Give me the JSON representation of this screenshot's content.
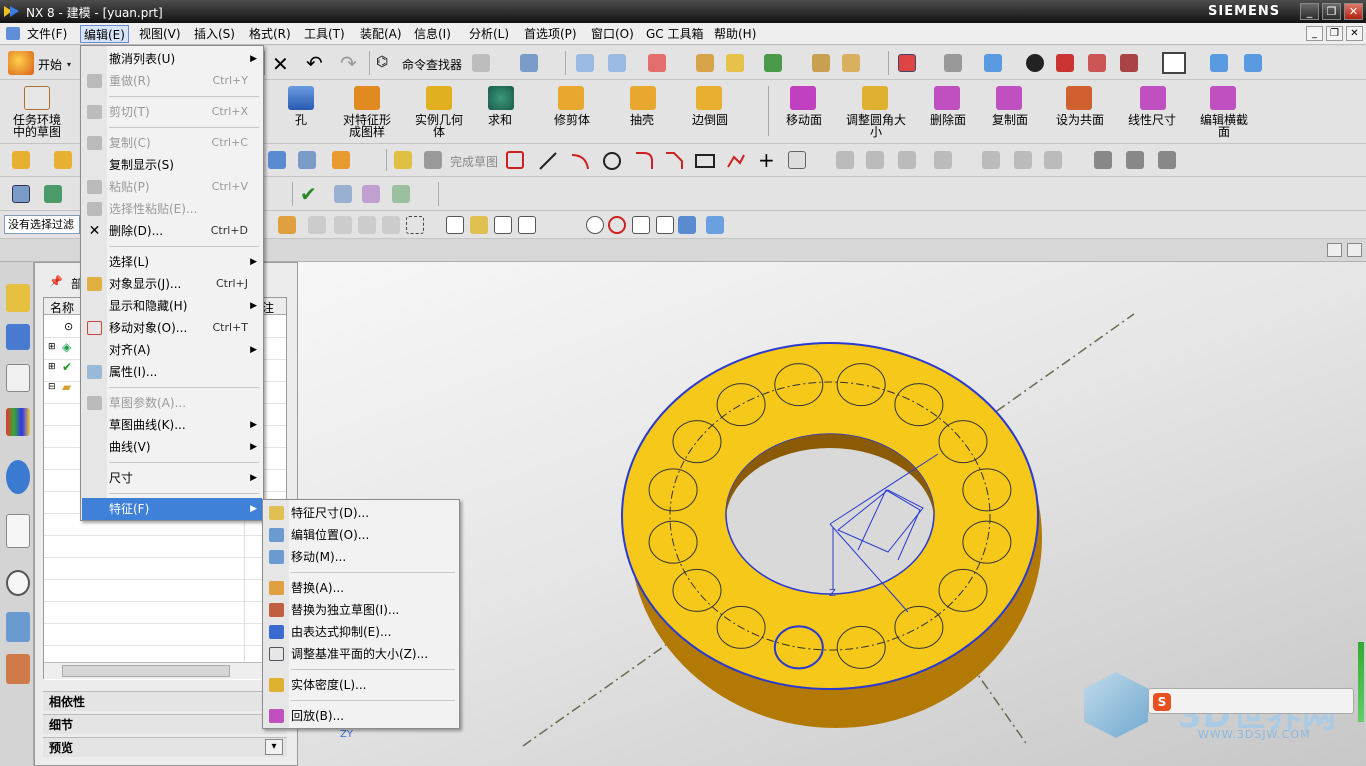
{
  "app": {
    "title": "NX 8 - 建模 - [yuan.prt]",
    "brand": "SIEMENS"
  },
  "menubar": [
    "编辑(E)",
    "视图(V)",
    "插入(S)",
    "格式(R)",
    "工具(T)",
    "装配(A)",
    "信息(I)",
    "分析(L)",
    "首选项(P)",
    "窗口(O)",
    "GC 工具箱",
    "帮助(H)"
  ],
  "menubar_file": "文件(F)",
  "toolbar1": {
    "start": "开始",
    "cmd_finder": "命令查找器"
  },
  "toolbar2": {
    "items": [
      "任务环境中的草图",
      "对特征形成图样",
      "实例几何体",
      "求和",
      "修剪体",
      "抽壳",
      "边倒圆",
      "移动面",
      "调整圆角大小",
      "删除面",
      "复制面",
      "设为共面",
      "线性尺寸",
      "编辑横截面"
    ],
    "hole": "孔"
  },
  "toolbar3": {
    "finish_sketch": "完成草图"
  },
  "selection_filter": "没有选择过滤",
  "edit_menu": [
    {
      "label": "撤消列表(U)",
      "shortcut": "",
      "arrow": true,
      "disabled": false
    },
    {
      "label": "重做(R)",
      "shortcut": "Ctrl+Y",
      "disabled": true
    },
    {
      "label": "剪切(T)",
      "shortcut": "Ctrl+X",
      "disabled": true
    },
    {
      "label": "复制(C)",
      "shortcut": "Ctrl+C",
      "disabled": true
    },
    {
      "label": "复制显示(S)",
      "shortcut": "",
      "disabled": false
    },
    {
      "label": "粘贴(P)",
      "shortcut": "Ctrl+V",
      "disabled": true
    },
    {
      "label": "选择性粘贴(E)...",
      "shortcut": "",
      "disabled": true
    },
    {
      "label": "删除(D)...",
      "shortcut": "Ctrl+D",
      "disabled": false
    },
    {
      "label": "选择(L)",
      "arrow": true
    },
    {
      "label": "对象显示(J)...",
      "shortcut": "Ctrl+J"
    },
    {
      "label": "显示和隐藏(H)",
      "arrow": true
    },
    {
      "label": "移动对象(O)...",
      "shortcut": "Ctrl+T"
    },
    {
      "label": "对齐(A)",
      "arrow": true
    },
    {
      "label": "属性(I)..."
    },
    {
      "label": "草图参数(A)...",
      "disabled": true
    },
    {
      "label": "草图曲线(K)...",
      "arrow": true
    },
    {
      "label": "曲线(V)",
      "arrow": true
    },
    {
      "label": "尺寸",
      "arrow": true
    },
    {
      "label": "特征(F)",
      "arrow": true,
      "highlight": true
    }
  ],
  "feature_menu": [
    "特征尺寸(D)...",
    "编辑位置(O)...",
    "移动(M)...",
    "替换(A)...",
    "替换为独立草图(I)...",
    "由表达式抑制(E)...",
    "调整基准平面的大小(Z)...",
    "实体密度(L)...",
    "回放(B)..."
  ],
  "nav": {
    "title": "部",
    "col_name": "名称",
    "col_right": "注",
    "panels": [
      "相依性",
      "细节",
      "预览"
    ]
  },
  "viewport": {
    "axis_z": "Z",
    "triad": "ZY"
  },
  "watermark": {
    "text": "3D世界网",
    "url": "WWW.3DSJW.COM"
  },
  "colors": {
    "part": "#f4c51a",
    "part_side": "#b87f04",
    "highlight": "#3f80d8"
  }
}
